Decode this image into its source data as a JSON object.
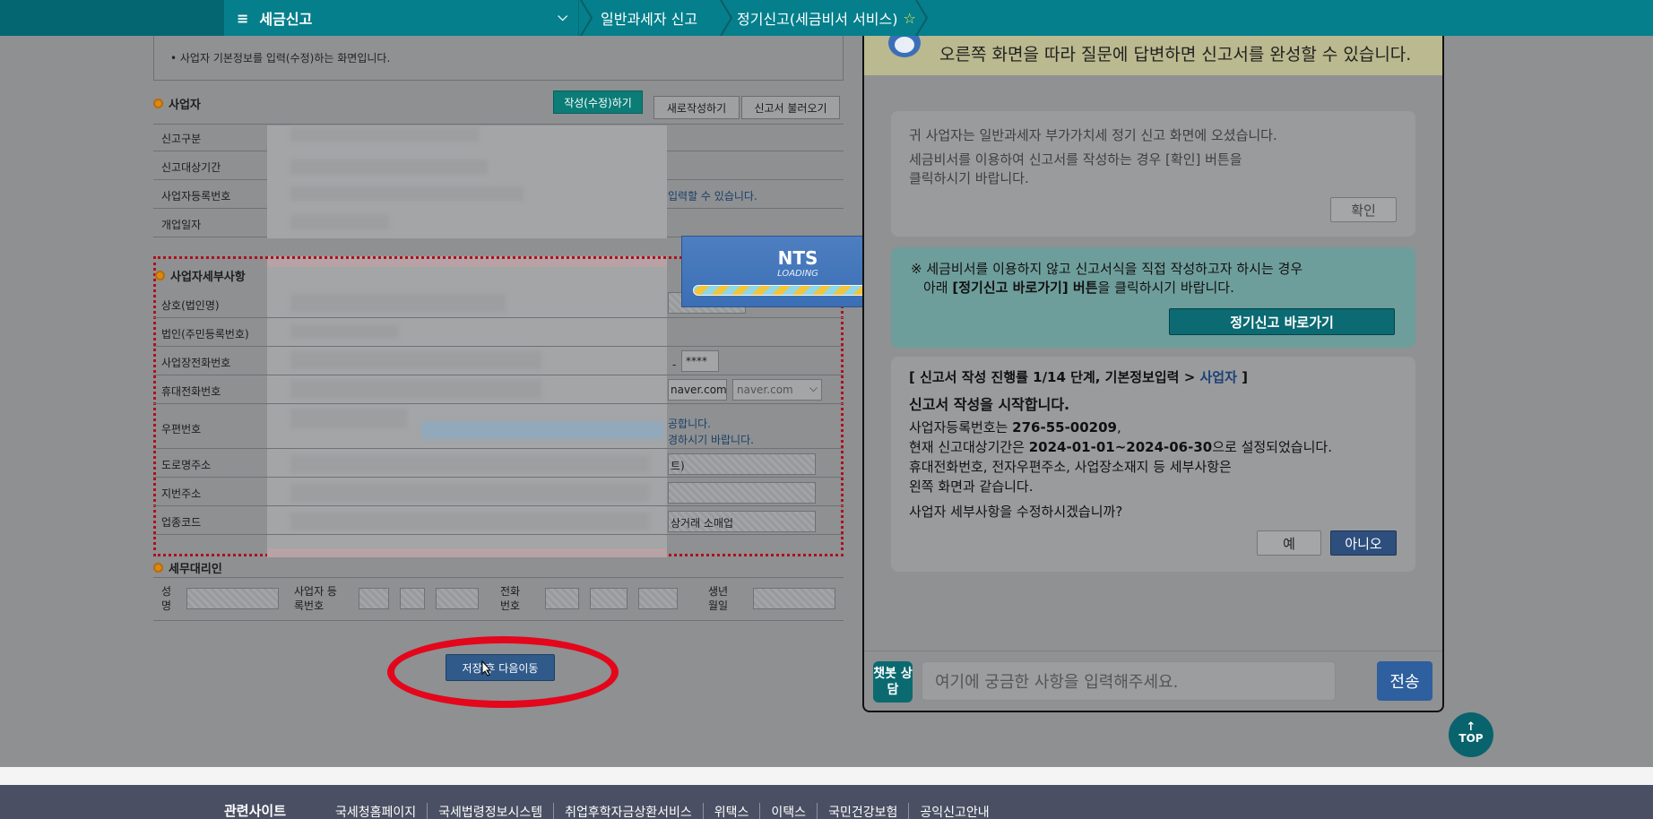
{
  "nav": {
    "menu_label": "세금신고",
    "crumb1": "일반과세자 신고",
    "crumb2": "정기신고(세금비서 서비스)"
  },
  "form": {
    "notice": "• 사업자 기본정보를 입력(수정)하는 화면입니다.",
    "section_business": "사업자",
    "btn_edit": "작성(수정)하기",
    "btn_new": "새로작성하기",
    "btn_load": "신고서 불러오기",
    "labels_top": [
      "신고구분",
      "신고대상기간",
      "사업자등록번호",
      "개업일자"
    ],
    "reg_hint": "입력할 수 있습니다.",
    "section_detail": "사업자세부사항",
    "labels_detail": [
      "상호(법인명)",
      "법인(주민등록번호)",
      "사업장전화번호",
      "휴대전화번호",
      "우편번호",
      "도로명주소",
      "지번주소",
      "업종코드"
    ],
    "phone_mask": "****",
    "email_domain": "naver.com",
    "email_select": "naver.com",
    "post_hint1": "공합니다.",
    "post_hint2": "경하시기 바랍니다.",
    "road_suffix": "트)",
    "industry_text": "상거래 소매업",
    "section_agent": "세무대리인",
    "agent_name": "성명",
    "agent_reg": "사업자 등록번호",
    "agent_phone": "전화 번호",
    "agent_birth": "생년 월일",
    "save_next": "저장 후 다음이동"
  },
  "loading": {
    "title": "NTS",
    "sub": "LOADING"
  },
  "chat": {
    "banner": "오른쪽 화면을 따라 질문에 답변하면 신고서를 완성할 수 있습니다.",
    "card1_line1": "귀 사업자는 일반과세자 부가가치세 정기 신고 화면에 오셨습니다.",
    "card1_line2": "세금비서를 이용하여 신고서를 작성하는 경우 [확인] 버튼을",
    "card1_line3": "클릭하시기 바랍니다.",
    "btn_confirm": "확인",
    "card2_line1": "※ 세금비서를 이용하지 않고 신고서식을 직접 작성하고자 하시는 경우",
    "card2_line2_pre": "아래 ",
    "card2_line2_bold": "[정기신고 바로가기] 버튼",
    "card2_line2_post": "을 클릭하시기 바랍니다.",
    "btn_shortcut": "정기신고 바로가기",
    "card3_progress_pre": "[ 신고서 작성 진행률 1/14 단계, 기본정보입력 > ",
    "card3_progress_link": "사업자",
    "card3_progress_post": " ]",
    "card3_start": "신고서 작성을 시작합니다.",
    "card3_reg_pre": "사업자등록번호는 ",
    "card3_reg_num": "276-55-00209",
    "card3_reg_post": ",",
    "card3_period_pre": "현재 신고대상기간은 ",
    "card3_period": "2024-01-01~2024-06-30",
    "card3_period_post": "으로 설정되었습니다.",
    "card3_line4": "휴대전화번호, 전자우편주소, 사업장소재지 등 세부사항은",
    "card3_line5": "왼쪽 화면과 같습니다.",
    "card3_question": "사업자 세부사항을 수정하시겠습니까?",
    "btn_yes": "예",
    "btn_no": "아니오",
    "badge": "챗봇 상담",
    "input_placeholder": "여기에 궁금한 사항을 입력해주세요.",
    "send": "전송"
  },
  "top_button": "TOP",
  "footer": {
    "label": "관련사이트",
    "links": [
      "국세청홈페이지",
      "국세법령정보시스템",
      "취업후학자금상환서비스",
      "위택스",
      "이택스",
      "국민건강보험",
      "공익신고안내"
    ]
  }
}
